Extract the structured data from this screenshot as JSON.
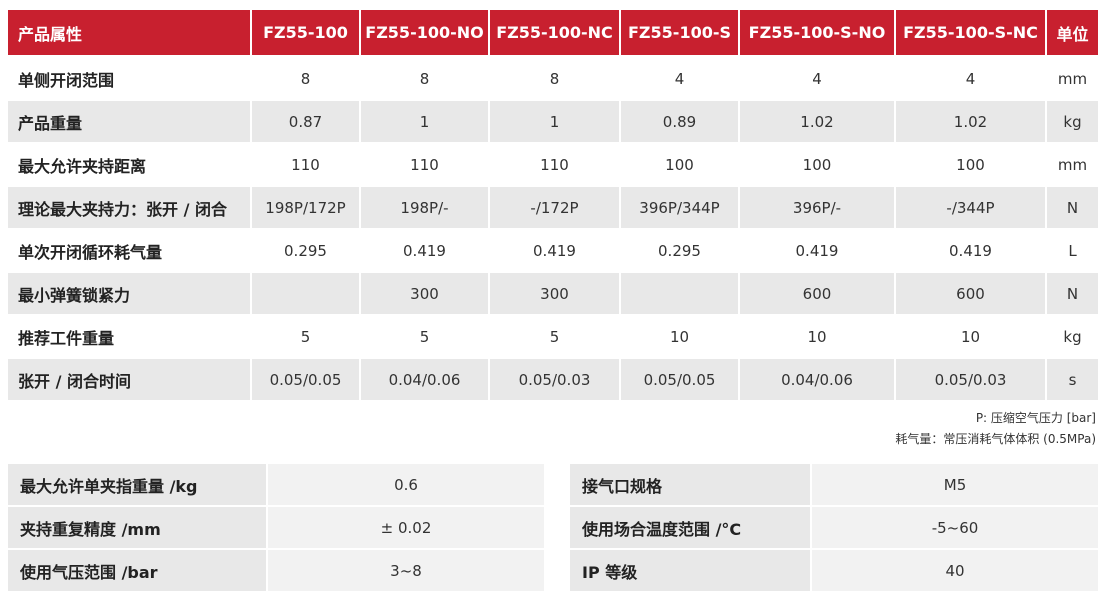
{
  "spec_table": {
    "headers": [
      "产品属性",
      "FZ55-100",
      "FZ55-100-NO",
      "FZ55-100-NC",
      "FZ55-100-S",
      "FZ55-100-S-NO",
      "FZ55-100-S-NC",
      "单位"
    ],
    "rows": [
      [
        "单侧开闭范围",
        "8",
        "8",
        "8",
        "4",
        "4",
        "4",
        "mm"
      ],
      [
        "产品重量",
        "0.87",
        "1",
        "1",
        "0.89",
        "1.02",
        "1.02",
        "kg"
      ],
      [
        "最大允许夹持距离",
        "110",
        "110",
        "110",
        "100",
        "100",
        "100",
        "mm"
      ],
      [
        "理论最大夹持力：张开 / 闭合",
        "198P/172P",
        "198P/-",
        "-/172P",
        "396P/344P",
        "396P/-",
        "-/344P",
        "N"
      ],
      [
        "单次开闭循环耗气量",
        "0.295",
        "0.419",
        "0.419",
        "0.295",
        "0.419",
        "0.419",
        "L"
      ],
      [
        "最小弹簧锁紧力",
        "",
        "300",
        "300",
        "",
        "600",
        "600",
        "N"
      ],
      [
        "推荐工件重量",
        "5",
        "5",
        "5",
        "10",
        "10",
        "10",
        "kg"
      ],
      [
        "张开 / 闭合时间",
        "0.05/0.05",
        "0.04/0.06",
        "0.05/0.03",
        "0.05/0.05",
        "0.04/0.06",
        "0.05/0.03",
        "s"
      ]
    ]
  },
  "notes": {
    "pressure": "P: 压缩空气压力 [bar]",
    "consumption": "耗气量：常压消耗气体体积 (0.5MPa)"
  },
  "extra_left": [
    {
      "label": "最大允许单夹指重量 /kg",
      "value": "0.6"
    },
    {
      "label": "夹持重复精度 /mm",
      "value": "± 0.02"
    },
    {
      "label": "使用气压范围 /bar",
      "value": "3~8"
    }
  ],
  "extra_right": [
    {
      "label": "接气口规格",
      "value": "M5"
    },
    {
      "label": "使用场合温度范围 /°C",
      "value": "-5~60"
    },
    {
      "label": "IP 等级",
      "value": "40"
    }
  ],
  "colors": {
    "header_bg": "#c8202f",
    "stripe": "#e8e8e8"
  }
}
